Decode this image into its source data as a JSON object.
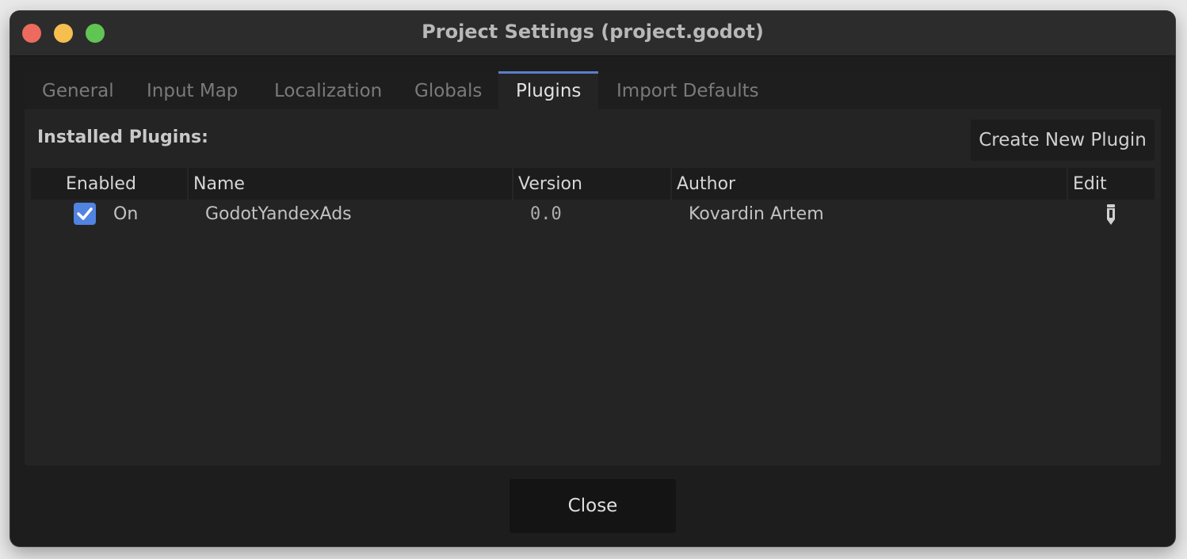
{
  "window": {
    "title": "Project Settings (project.godot)"
  },
  "tabs": [
    {
      "label": "General"
    },
    {
      "label": "Input Map"
    },
    {
      "label": "Localization"
    },
    {
      "label": "Globals"
    },
    {
      "label": "Plugins",
      "active": true
    },
    {
      "label": "Import Defaults"
    }
  ],
  "plugins_panel": {
    "installed_label": "Installed Plugins:",
    "create_button_label": "Create New Plugin",
    "columns": [
      "Enabled",
      "Name",
      "Version",
      "Author",
      "Edit"
    ],
    "rows": [
      {
        "enabled": true,
        "status": "On",
        "name": "GodotYandexAds",
        "version": "0.0",
        "author": "Kovardin Artem",
        "edit_icon": "pencil-icon"
      }
    ]
  },
  "footer": {
    "close_label": "Close"
  },
  "colors": {
    "accent": "#5b7fc9",
    "checkbox": "#5183e0",
    "close_light": "#ed6a5e",
    "minimize_light": "#f5be4f",
    "maximize_light": "#61c554"
  }
}
